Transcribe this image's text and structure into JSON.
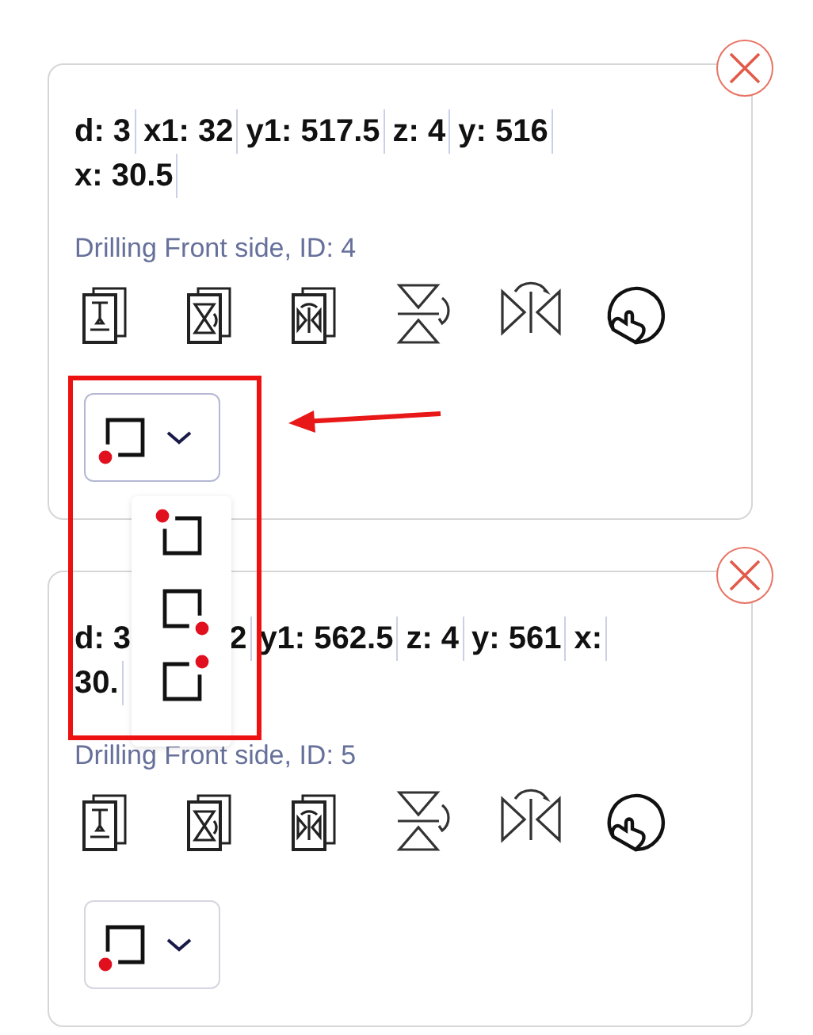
{
  "cards": [
    {
      "fields": [
        {
          "text": "d: 3",
          "cut": false
        },
        {
          "text": "x1: 32",
          "cut": false
        },
        {
          "text": "y1: 517.5",
          "cut": false
        },
        {
          "text": "z: 4",
          "cut": false
        },
        {
          "text": "y: 516",
          "cut": false
        },
        {
          "text": "x: 30.5",
          "cut": false
        }
      ],
      "title": "Drilling Front side, ID: 4",
      "tools": [
        {
          "kind": "drill"
        },
        {
          "kind": "hourglass"
        },
        {
          "kind": "mirror"
        },
        {
          "kind": "flip-v"
        },
        {
          "kind": "flip-h"
        },
        {
          "kind": "touch"
        }
      ],
      "corner": {
        "kind": "bottom-left",
        "open": true,
        "options": [
          {
            "kind": "top-left"
          },
          {
            "kind": "bottom-right"
          },
          {
            "kind": "top-right"
          }
        ]
      }
    },
    {
      "fields": [
        {
          "text": "d: 3",
          "cut": false
        },
        {
          "text": "2",
          "cut": true
        },
        {
          "text": "y1: 562.5",
          "cut": false
        },
        {
          "text": "z: 4",
          "cut": false
        },
        {
          "text": "y: 561",
          "cut": false
        },
        {
          "text": "x:",
          "cut": false
        },
        {
          "text": "30.",
          "cut": false
        }
      ],
      "title": "Drilling Front side, ID: 5",
      "tools": [
        {
          "kind": "drill"
        },
        {
          "kind": "hourglass"
        },
        {
          "kind": "mirror"
        },
        {
          "kind": "flip-v"
        },
        {
          "kind": "flip-h"
        },
        {
          "kind": "touch"
        }
      ],
      "corner": {
        "kind": "bottom-left",
        "open": false
      }
    }
  ]
}
